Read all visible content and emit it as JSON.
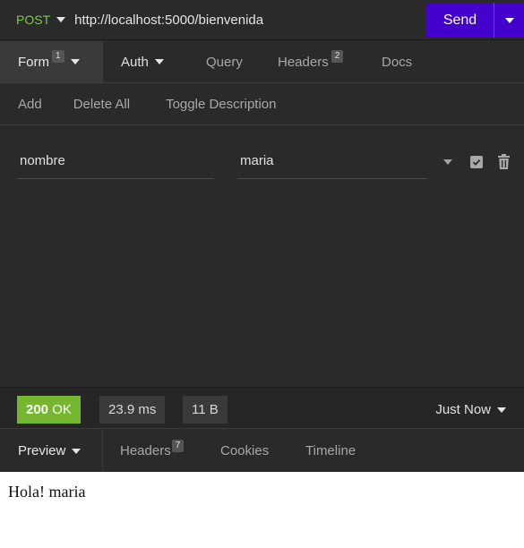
{
  "request": {
    "method": "POST",
    "url": "http://localhost:5000/bienvenida",
    "send_label": "Send"
  },
  "request_tabs": {
    "form": {
      "label": "Form",
      "badge": "1"
    },
    "auth": {
      "label": "Auth"
    },
    "query": {
      "label": "Query"
    },
    "headers": {
      "label": "Headers",
      "badge": "2"
    },
    "docs": {
      "label": "Docs"
    }
  },
  "toolbar": {
    "add": "Add",
    "delete_all": "Delete All",
    "toggle_description": "Toggle Description"
  },
  "params": [
    {
      "name": "nombre",
      "value": "maria",
      "enabled": true
    }
  ],
  "response": {
    "status_code": "200",
    "status_text": "OK",
    "time": "23.9 ms",
    "size": "11 B",
    "history": "Just Now",
    "body": "Hola! maria"
  },
  "response_tabs": {
    "preview": {
      "label": "Preview"
    },
    "headers": {
      "label": "Headers",
      "badge": "7"
    },
    "cookies": {
      "label": "Cookies"
    },
    "timeline": {
      "label": "Timeline"
    }
  },
  "colors": {
    "accent": "#4400cc",
    "method_post": "#7bc94f",
    "status_ok": "#75b72e",
    "background": "#2a2a2a"
  }
}
